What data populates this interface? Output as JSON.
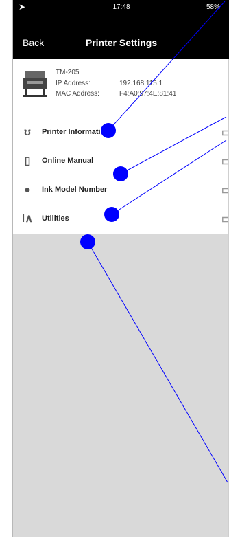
{
  "status_bar": {
    "time": "17:48",
    "battery": "58%"
  },
  "nav": {
    "back_label": "Back",
    "title": "Printer Settings"
  },
  "printer": {
    "model": "TM-205",
    "ip_label": "IP Address:",
    "ip_value": "192.168.115.1",
    "mac_label": "MAC Address:",
    "mac_value": "F4:A0:97:4E:81:41"
  },
  "menu": {
    "items": [
      {
        "label": "Printer Information",
        "icon": "printer-info-icon"
      },
      {
        "label": "Online Manual",
        "icon": "manual-icon"
      },
      {
        "label": "Ink Model Number",
        "icon": "ink-icon"
      },
      {
        "label": "Utilities",
        "icon": "tools-icon"
      }
    ]
  },
  "annotation": {
    "color": "#0000ff"
  }
}
